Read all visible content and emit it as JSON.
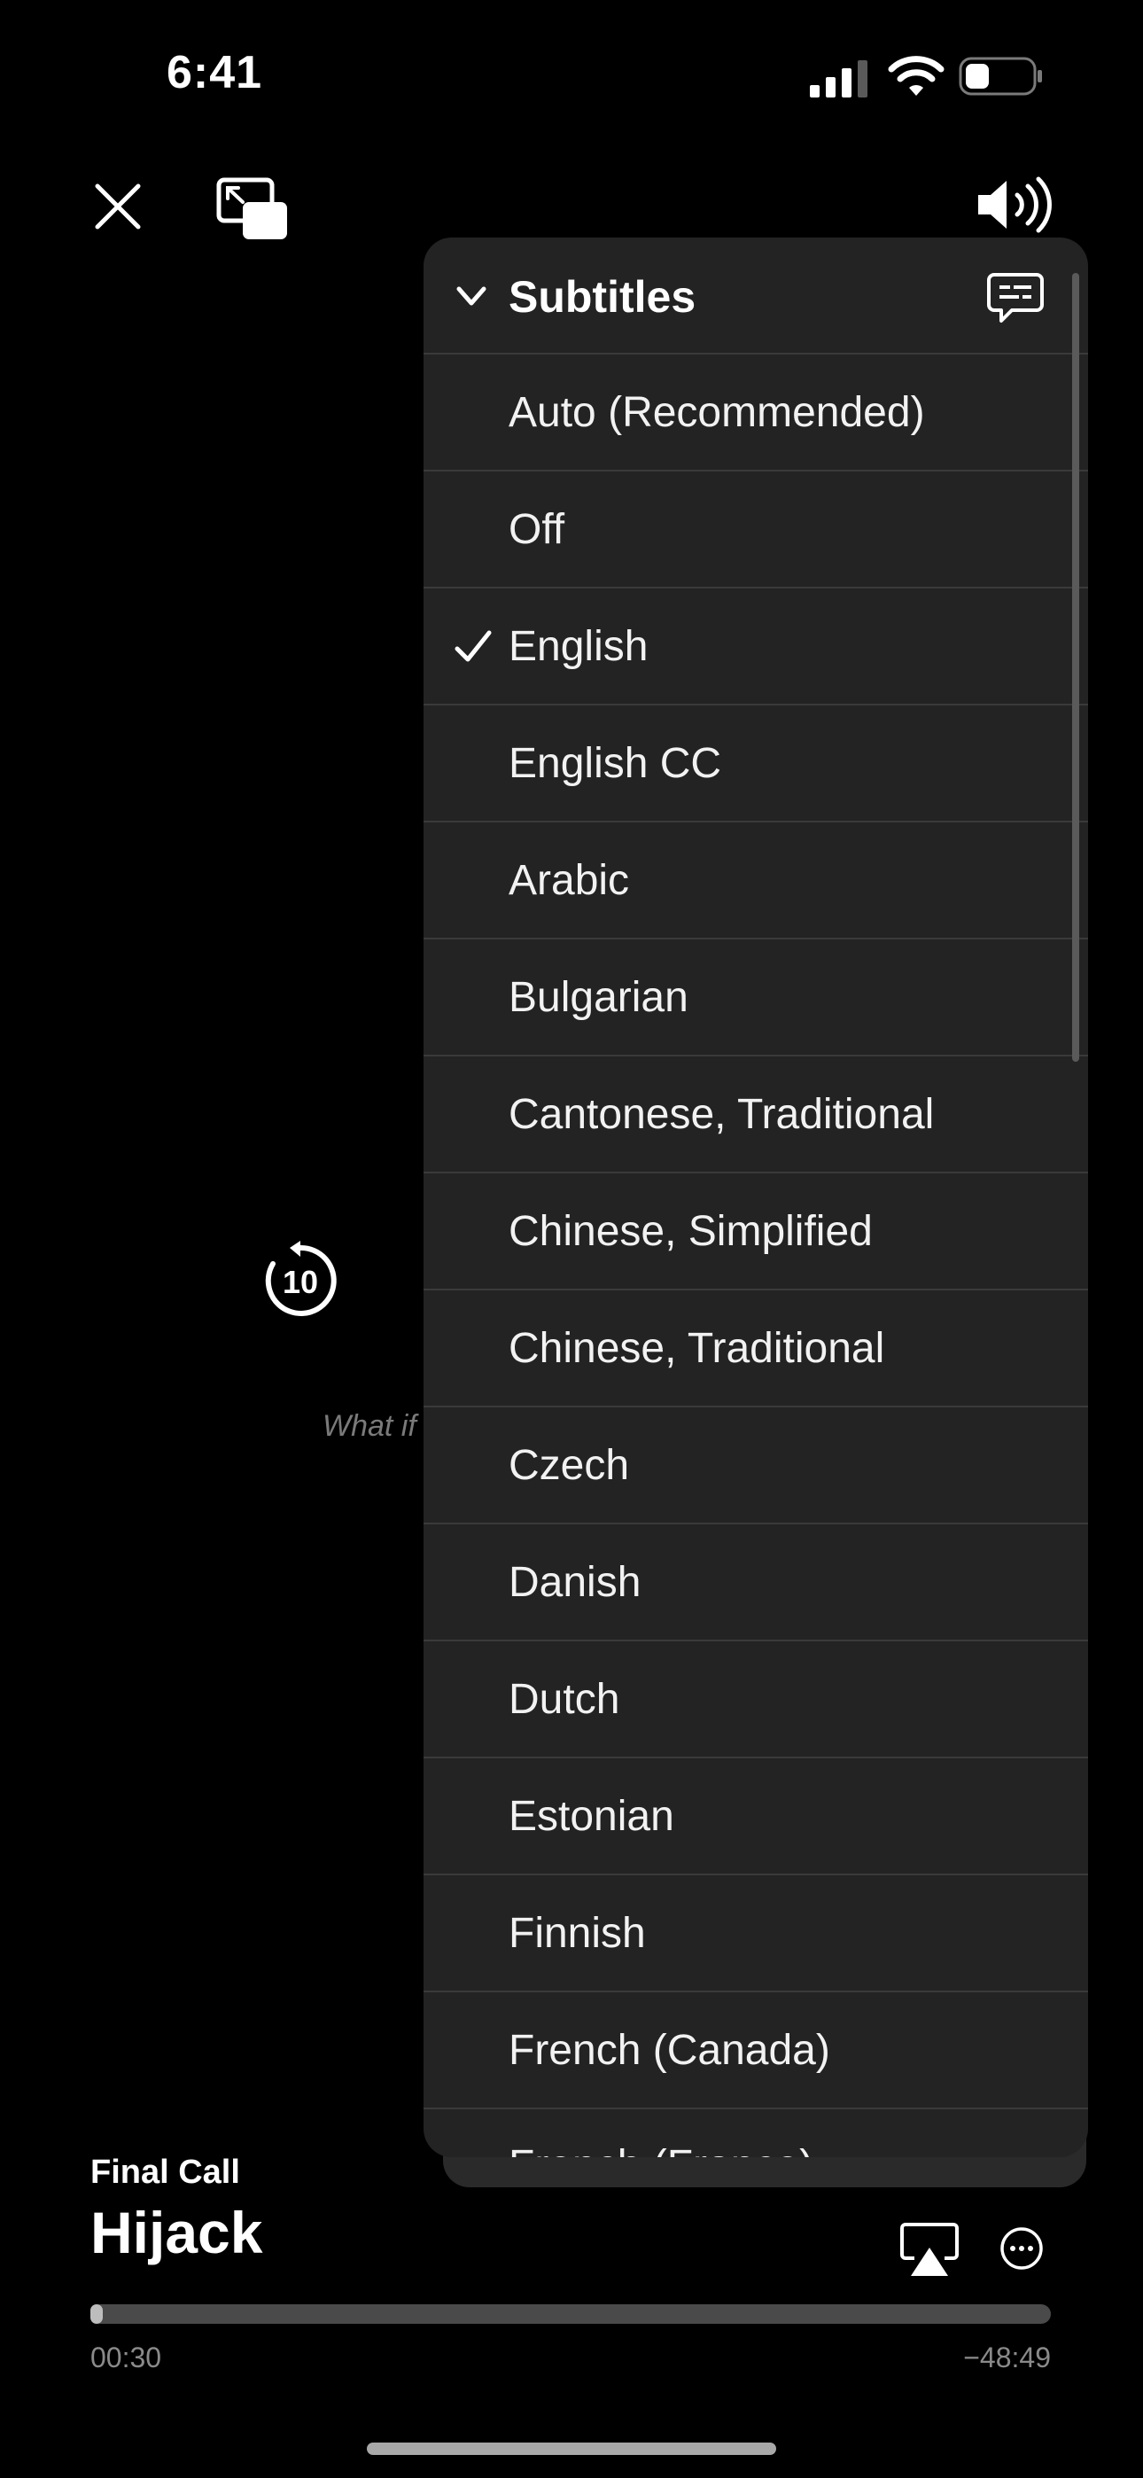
{
  "status_bar": {
    "time": "6:41",
    "icons": [
      "signal-icon",
      "wifi-icon",
      "battery-icon"
    ]
  },
  "player": {
    "icons": [
      "close-icon",
      "picture-in-picture-icon",
      "volume-icon",
      "skip-back-10-icon",
      "airplay-icon",
      "more-icon"
    ],
    "replay_seconds": "10",
    "caption_text": "What if",
    "episode": "Final Call",
    "show": "Hijack",
    "elapsed": "00:30",
    "remaining": "−48:49",
    "progress_fraction": 0.01
  },
  "subtitles_menu": {
    "title": "Subtitles",
    "selected": "English",
    "items": [
      {
        "label": "Auto (Recommended)",
        "checked": false
      },
      {
        "label": "Off",
        "checked": false
      },
      {
        "label": "English",
        "checked": true
      },
      {
        "label": "English CC",
        "checked": false
      },
      {
        "label": "Arabic",
        "checked": false
      },
      {
        "label": "Bulgarian",
        "checked": false
      },
      {
        "label": "Cantonese, Traditional",
        "checked": false
      },
      {
        "label": "Chinese, Simplified",
        "checked": false
      },
      {
        "label": "Chinese, Traditional",
        "checked": false
      },
      {
        "label": "Czech",
        "checked": false
      },
      {
        "label": "Danish",
        "checked": false
      },
      {
        "label": "Dutch",
        "checked": false
      },
      {
        "label": "Estonian",
        "checked": false
      },
      {
        "label": "Finnish",
        "checked": false
      },
      {
        "label": "French (Canada)",
        "checked": false
      },
      {
        "label": "French (France)",
        "checked": false
      }
    ]
  }
}
